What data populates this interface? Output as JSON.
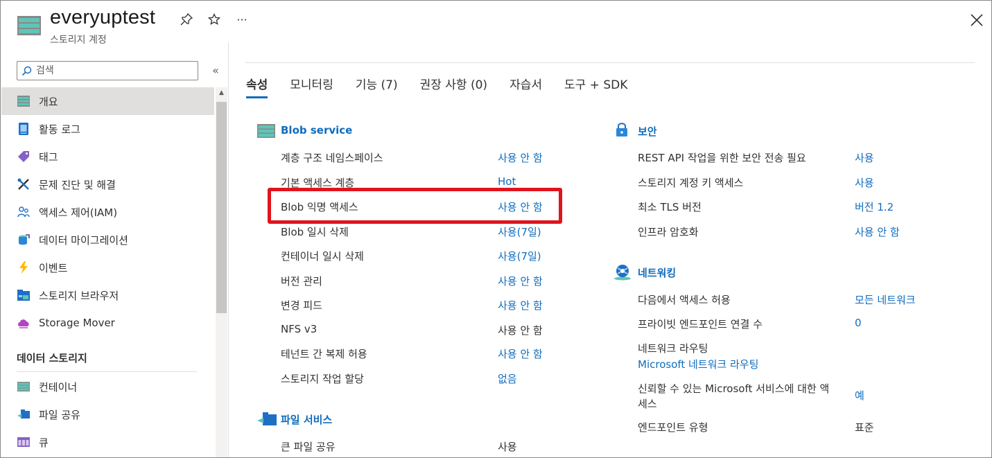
{
  "header": {
    "title": "everyuptest",
    "subtitle": "스토리지 계정",
    "more_label": "···"
  },
  "sidebar": {
    "search_placeholder": "검색",
    "collapse_label": "«",
    "items": [
      {
        "label": "개요",
        "icon": "overview-icon"
      },
      {
        "label": "활동 로그",
        "icon": "activity-log-icon"
      },
      {
        "label": "태그",
        "icon": "tag-icon"
      },
      {
        "label": "문제 진단 및 해결",
        "icon": "wrench-icon"
      },
      {
        "label": "액세스 제어(IAM)",
        "icon": "people-icon"
      },
      {
        "label": "데이터 마이그레이션",
        "icon": "migration-icon"
      },
      {
        "label": "이벤트",
        "icon": "lightning-icon"
      },
      {
        "label": "스토리지 브라우저",
        "icon": "storage-browser-icon"
      },
      {
        "label": "Storage Mover",
        "icon": "cloud-icon"
      }
    ],
    "section_label": "데이터 스토리지",
    "section_items": [
      {
        "label": "컨테이너",
        "icon": "container-icon"
      },
      {
        "label": "파일 공유",
        "icon": "file-share-icon"
      },
      {
        "label": "큐",
        "icon": "queue-icon"
      }
    ]
  },
  "tabs": [
    {
      "label": "속성",
      "active": true
    },
    {
      "label": "모니터링",
      "active": false
    },
    {
      "label": "기능 (7)",
      "active": false
    },
    {
      "label": "권장 사항 (0)",
      "active": false
    },
    {
      "label": "자습서",
      "active": false
    },
    {
      "label": "도구 + SDK",
      "active": false
    }
  ],
  "blob_service": {
    "title": "Blob service",
    "rows": [
      {
        "label": "계층 구조 네임스페이스",
        "value": "사용 안 함",
        "link": true
      },
      {
        "label": "기본 액세스 계층",
        "value": "Hot",
        "link": true
      },
      {
        "label": "Blob 익명 액세스",
        "value": "사용 안 함",
        "link": true
      },
      {
        "label": "Blob 일시 삭제",
        "value": "사용(7일)",
        "link": true
      },
      {
        "label": "컨테이너 일시 삭제",
        "value": "사용(7일)",
        "link": true
      },
      {
        "label": "버전 관리",
        "value": "사용 안 함",
        "link": true
      },
      {
        "label": "변경 피드",
        "value": "사용 안 함",
        "link": true
      },
      {
        "label": "NFS v3",
        "value": "사용 안 함",
        "link": false
      },
      {
        "label": "테넌트 간 복제 허용",
        "value": "사용 안 함",
        "link": true
      },
      {
        "label": "스토리지 작업 할당",
        "value": "없음",
        "link": true
      }
    ]
  },
  "file_service": {
    "title": "파일 서비스",
    "rows": [
      {
        "label": "큰 파일 공유",
        "value": "사용",
        "link": false
      }
    ]
  },
  "security": {
    "title": "보안",
    "rows": [
      {
        "label": "REST API 작업을 위한 보안 전송 필요",
        "value": "사용",
        "link": true
      },
      {
        "label": "스토리지 계정 키 액세스",
        "value": "사용",
        "link": true
      },
      {
        "label": "최소 TLS 버전",
        "value": "버전 1.2",
        "link": true
      },
      {
        "label": "인프라 암호화",
        "value": "사용 안 함",
        "link": true
      }
    ]
  },
  "networking": {
    "title": "네트워킹",
    "rows": [
      {
        "label": "다음에서 액세스 허용",
        "value": "모든 네트워크",
        "link": true
      },
      {
        "label": "프라이빗 엔드포인트 연결 수",
        "value": "0",
        "link": true
      },
      {
        "label": "네트워크 라우팅",
        "value": "Microsoft 네트워크 라우팅",
        "link": true
      },
      {
        "label_line1": "신뢰할 수 있는 Microsoft 서비스에 대한 액",
        "label_line2": "세스",
        "value": "예",
        "link": true
      },
      {
        "label": "엔드포인트 유형",
        "value": "표준",
        "link": false
      }
    ]
  },
  "colors": {
    "link": "#0f6cbd",
    "highlight_border": "#e0141e",
    "active_nav": "#e1dfdd"
  }
}
